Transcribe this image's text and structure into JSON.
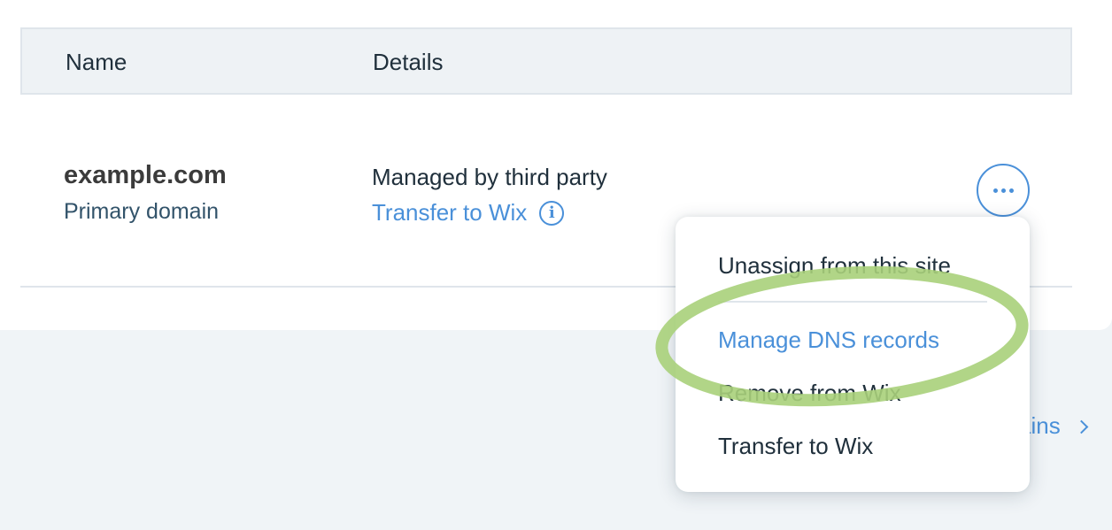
{
  "table": {
    "headers": {
      "name": "Name",
      "details": "Details"
    },
    "rows": [
      {
        "domain": "example.com",
        "domain_type": "Primary domain",
        "status": "Managed by third party",
        "action_link": "Transfer to Wix"
      }
    ]
  },
  "footer": {
    "link_fragment": "ains"
  },
  "menu": {
    "items": [
      {
        "label": "Unassign from this site"
      },
      {
        "label": "Manage DNS records",
        "highlighted": true
      },
      {
        "label": "Remove from Wix"
      },
      {
        "label": "Transfer to Wix"
      }
    ]
  },
  "icons": {
    "info": "info-icon",
    "more": "more-actions-icon",
    "chevron": "chevron-right-icon"
  },
  "colors": {
    "link": "#4a90d9",
    "text": "#20303c",
    "header_bg": "#eef2f5",
    "page_bg": "#f0f4f7",
    "highlight_ring": "#a9d07a"
  }
}
